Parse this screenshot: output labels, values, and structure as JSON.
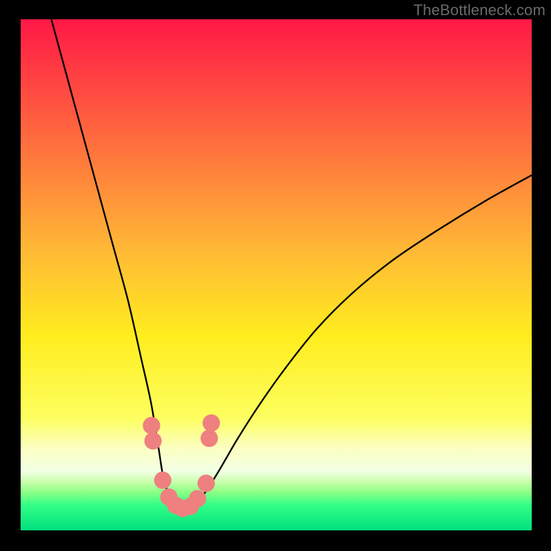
{
  "watermark": "TheBottleneck.com",
  "chart_data": {
    "type": "line",
    "title": "",
    "xlabel": "",
    "ylabel": "",
    "xlim": [
      0,
      100
    ],
    "ylim": [
      0,
      100
    ],
    "background_gradient": {
      "stops": [
        {
          "offset": 0.0,
          "color": "#ff1846"
        },
        {
          "offset": 0.45,
          "color": "#ffb836"
        },
        {
          "offset": 0.62,
          "color": "#ffed1e"
        },
        {
          "offset": 0.78,
          "color": "#fdff60"
        },
        {
          "offset": 0.84,
          "color": "#fcffc3"
        },
        {
          "offset": 0.885,
          "color": "#f1ffe4"
        },
        {
          "offset": 0.905,
          "color": "#c9ffab"
        },
        {
          "offset": 0.925,
          "color": "#8dff86"
        },
        {
          "offset": 0.95,
          "color": "#34ff87"
        },
        {
          "offset": 1.0,
          "color": "#00e07e"
        }
      ]
    },
    "series": [
      {
        "name": "bottleneck-curve",
        "x": [
          6,
          9,
          12,
          15,
          18,
          21,
          23.5,
          25.5,
          27,
          28,
          29.5,
          31,
          32.8,
          34.5,
          36.5,
          39,
          42.5,
          47,
          52,
          58,
          65,
          73,
          82,
          91,
          100
        ],
        "y": [
          100,
          89,
          78,
          67,
          56,
          45,
          34,
          25,
          16,
          10,
          6,
          4.2,
          4.2,
          5.5,
          8,
          12,
          18,
          25,
          32,
          39.5,
          46.5,
          53,
          59,
          64.5,
          69.5
        ]
      }
    ],
    "markers": [
      {
        "x": 25.6,
        "y": 20.5,
        "r": 1.7
      },
      {
        "x": 25.9,
        "y": 17.5,
        "r": 1.7
      },
      {
        "x": 27.8,
        "y": 9.8,
        "r": 1.7
      },
      {
        "x": 29.0,
        "y": 6.5,
        "r": 1.7
      },
      {
        "x": 30.3,
        "y": 4.9,
        "r": 1.7
      },
      {
        "x": 31.7,
        "y": 4.3,
        "r": 1.7
      },
      {
        "x": 33.2,
        "y": 4.7,
        "r": 1.7
      },
      {
        "x": 34.6,
        "y": 6.2,
        "r": 1.7
      },
      {
        "x": 36.3,
        "y": 9.2,
        "r": 1.7
      },
      {
        "x": 36.9,
        "y": 18.0,
        "r": 1.7
      },
      {
        "x": 37.3,
        "y": 21.0,
        "r": 1.7
      }
    ],
    "marker_color": "#ee8080",
    "curve_color": "#000000"
  }
}
